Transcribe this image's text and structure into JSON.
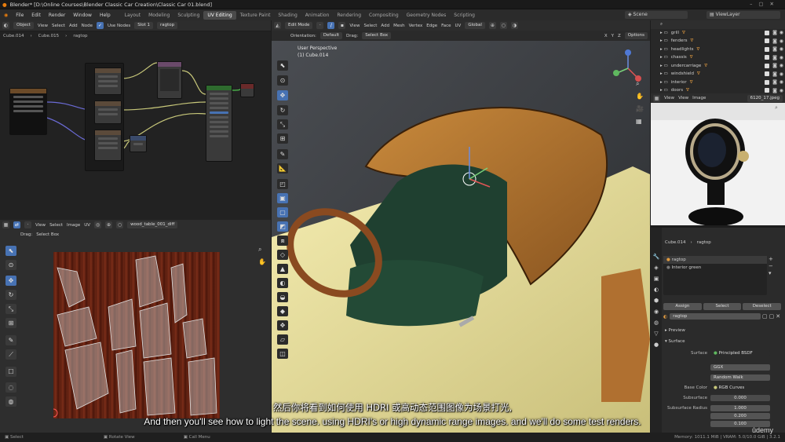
{
  "window": {
    "title": "Blender* [D:\\Online Courses\\Blender Classic Car Creation\\Classic Car 01.blend]"
  },
  "menu": [
    "File",
    "Edit",
    "Render",
    "Window",
    "Help"
  ],
  "workspaces": [
    "Layout",
    "Modeling",
    "Sculpting",
    "UV Editing",
    "Texture Paint",
    "Shading",
    "Animation",
    "Rendering",
    "Compositing",
    "Geometry Nodes",
    "Scripting"
  ],
  "active_workspace": "UV Editing",
  "scene": {
    "label": "Scene",
    "view_layer": "ViewLayer"
  },
  "node_editor": {
    "header": {
      "mode": "Object",
      "menus": [
        "View",
        "Select",
        "Add",
        "Node"
      ],
      "use_nodes": "Use Nodes",
      "slot": "Slot 1",
      "material": "ragtop"
    },
    "breadcrumb": [
      "Cube.014",
      "Cube.015",
      "ragtop"
    ]
  },
  "uv_editor": {
    "header": {
      "menus": [
        "View",
        "Select",
        "Image",
        "UV"
      ],
      "image": "wood_table_001_diff",
      "drag_label": "Drag:",
      "drag_value": "Select Box"
    }
  },
  "viewport": {
    "header": {
      "mode": "Edit Mode",
      "menus": [
        "View",
        "Select",
        "Add",
        "Mesh",
        "Vertex",
        "Edge",
        "Face",
        "UV"
      ],
      "transform": "Global",
      "options": "Options"
    },
    "subheader": {
      "orientation_label": "Orientation:",
      "orientation": "Default",
      "drag_label": "Drag:",
      "drag": "Select Box"
    },
    "overlay_line1": "User Perspective",
    "overlay_line2": "(1) Cube.014",
    "xyz": [
      "X",
      "Y",
      "Z"
    ]
  },
  "outliner": {
    "items": [
      "grill",
      "fenders",
      "headlights",
      "chassis",
      "undercarriage",
      "windshield",
      "interior",
      "doors"
    ]
  },
  "image_editor": {
    "menus": [
      "View",
      "View",
      "Image"
    ],
    "image_name": "6120_17.jpeg"
  },
  "properties": {
    "object": "Cube.014",
    "material": "ragtop",
    "slots": [
      "ragtop",
      "Interior green"
    ],
    "buttons": [
      "Assign",
      "Select",
      "Deselect"
    ],
    "material_field": "ragtop",
    "sections": {
      "preview": "Preview",
      "surface": "Surface"
    },
    "surface": {
      "label": "Surface",
      "value": "Principled BSDF"
    },
    "distribution": "GGX",
    "subsurface_method": "Random Walk",
    "base_color": {
      "label": "Base Color",
      "value": "RGB Curves"
    },
    "subsurface": {
      "label": "Subsurface",
      "value": "0.000"
    },
    "subsurface_radius": {
      "label": "Subsurface Radius",
      "values": [
        "1.000",
        "0.200",
        "0.100"
      ]
    }
  },
  "statusbar": {
    "items": [
      "Select",
      "Rotate View",
      "Call Menu"
    ],
    "memory": "Memory: 1011.1 MiB | VRAM: 5.0/10.0 GiB | 3.2.1"
  },
  "subtitles": {
    "chinese": "然后你将看到如何使用 HDRI 或高动态范围图像为场景打光,",
    "english": "And then you'll see how to light the scene. using HDRI's or high dynamic range images. and we'll do some test renders."
  },
  "watermark": "ûdemy"
}
